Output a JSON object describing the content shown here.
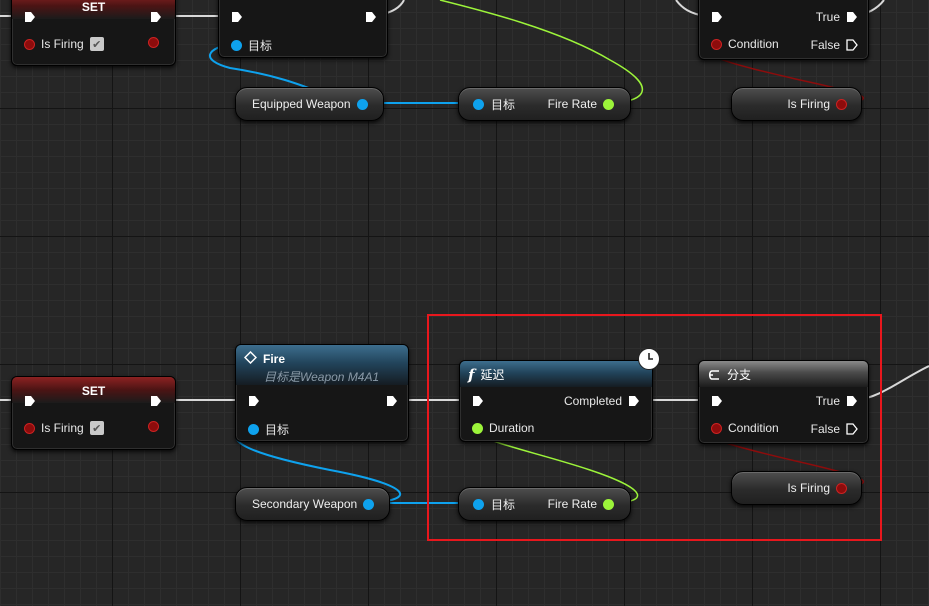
{
  "colors": {
    "exec": "#ffffff",
    "object_pin": "#0ea2ee",
    "float_pin": "#9cf43a",
    "bool_pin": "#8d0c0c",
    "selection": "#e8171d"
  },
  "top": {
    "set_node": {
      "title": "SET",
      "var_label": "Is Firing"
    },
    "call_node": {
      "target_label": "目标"
    },
    "equipped_weapon": {
      "label": "Equipped Weapon"
    },
    "get_fire_rate": {
      "target_label": "目标",
      "output_label": "Fire Rate"
    },
    "branch_node": {
      "true_label": "True",
      "condition_label": "Condition",
      "false_label": "False"
    },
    "is_firing_get": {
      "label": "Is Firing"
    }
  },
  "bottom": {
    "set_node": {
      "title": "SET",
      "var_label": "Is Firing"
    },
    "fire_node": {
      "title": "Fire",
      "subtitle": "目标是Weapon M4A1",
      "target_label": "目标"
    },
    "secondary_weapon": {
      "label": "Secondary Weapon"
    },
    "delay_node": {
      "title": "延迟",
      "completed_label": "Completed",
      "duration_label": "Duration"
    },
    "get_fire_rate": {
      "target_label": "目标",
      "output_label": "Fire Rate"
    },
    "branch_node": {
      "title": "分支",
      "true_label": "True",
      "condition_label": "Condition",
      "false_label": "False"
    },
    "is_firing_get": {
      "label": "Is Firing"
    }
  },
  "icons": {
    "function": "function-icon",
    "event": "diamond-icon",
    "branch": "branch-icon",
    "latent": "clock-icon",
    "check": "checkmark-icon"
  }
}
